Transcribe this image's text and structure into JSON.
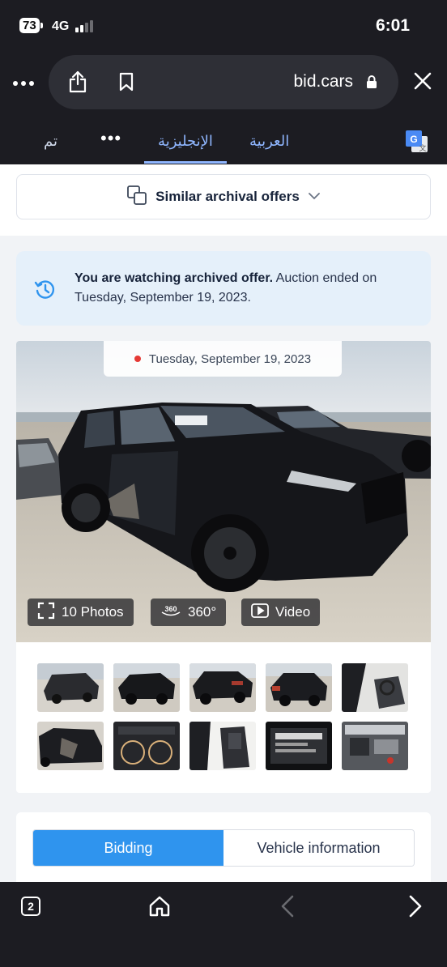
{
  "status_bar": {
    "battery": "73",
    "network": "4G",
    "time": "6:01"
  },
  "browser": {
    "more_icon": "more-horizontal-icon",
    "url": "bid.cars",
    "share_icon": "share-icon",
    "bookmark_icon": "bookmark-icon",
    "lock_icon": "lock-icon",
    "close_icon": "close-icon"
  },
  "translate_bar": {
    "done": "تم",
    "more": "•••",
    "english": "الإنجليزية",
    "arabic": "العربية",
    "translate_icon": "google-translate-icon"
  },
  "similar_offers": {
    "label": "Similar archival offers",
    "icon": "copy-icon",
    "chevron": "chevron-down-icon"
  },
  "archive_notice": {
    "bold": "You are watching archived offer.",
    "text": " Auction ended on Tuesday, September 19, 2023.",
    "icon": "history-icon"
  },
  "media": {
    "date": "Tuesday, September 19, 2023",
    "photos_label": "10 Photos",
    "view360_label": "360°",
    "view360_badge": "360",
    "video_label": "Video"
  },
  "tabs": {
    "bidding": "Bidding",
    "vehicle_info": "Vehicle information"
  },
  "bottom_bar": {
    "tab_count": "2",
    "home_icon": "home-icon",
    "back_icon": "chevron-left-icon",
    "forward_icon": "chevron-right-icon"
  },
  "colors": {
    "chrome": "#1c1c22",
    "accent_blue": "#2f94ee",
    "notice_bg": "#e5f0fa",
    "translate_blue": "#8fb6ff"
  }
}
